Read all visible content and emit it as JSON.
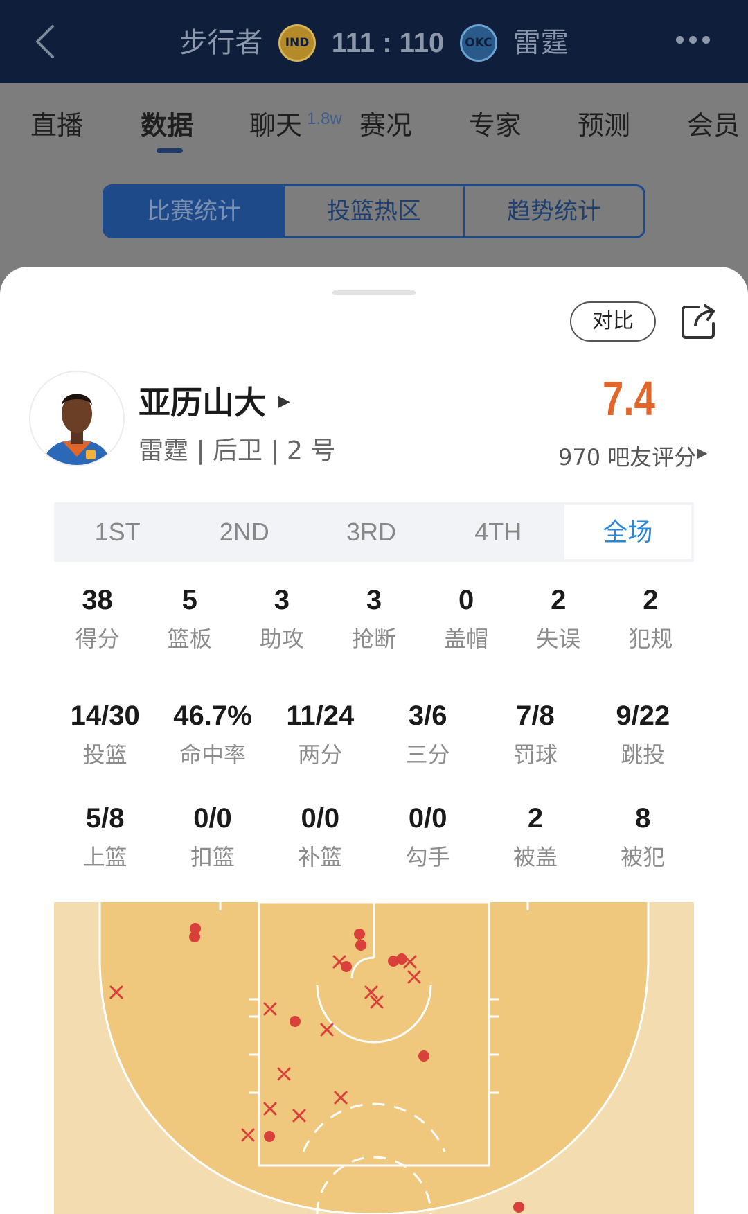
{
  "header": {
    "home_team": "步行者",
    "home_logo": "IND",
    "score": "111 : 110",
    "away_logo": "OKC",
    "away_team": "雷霆",
    "back_icon": "chevron-left-icon",
    "more_icon": "more-dots-icon"
  },
  "tabs": [
    {
      "label": "直播",
      "active": false
    },
    {
      "label": "数据",
      "active": true
    },
    {
      "label": "聊天",
      "active": false,
      "badge": "1.8w"
    },
    {
      "label": "赛况",
      "active": false
    },
    {
      "label": "专家",
      "active": false
    },
    {
      "label": "预测",
      "active": false
    },
    {
      "label": "会员",
      "active": false
    }
  ],
  "segments": [
    {
      "label": "比赛统计",
      "active": true
    },
    {
      "label": "投篮热区",
      "active": false
    },
    {
      "label": "趋势统计",
      "active": false
    }
  ],
  "sheet": {
    "compare_label": "对比",
    "share_icon": "share-icon"
  },
  "player": {
    "name": "亚历山大",
    "meta": "雷霆 | 后卫 | 2 号",
    "rating": "7.4",
    "rating_count": "970 吧友评分"
  },
  "quarters": [
    {
      "label": "1ST",
      "active": false
    },
    {
      "label": "2ND",
      "active": false
    },
    {
      "label": "3RD",
      "active": false
    },
    {
      "label": "4TH",
      "active": false
    },
    {
      "label": "全场",
      "active": true
    }
  ],
  "stats_row1": [
    {
      "value": "38",
      "label": "得分"
    },
    {
      "value": "5",
      "label": "篮板"
    },
    {
      "value": "3",
      "label": "助攻"
    },
    {
      "value": "3",
      "label": "抢断"
    },
    {
      "value": "0",
      "label": "盖帽"
    },
    {
      "value": "2",
      "label": "失误"
    },
    {
      "value": "2",
      "label": "犯规"
    }
  ],
  "stats_row2": [
    {
      "value": "14/30",
      "label": "投篮"
    },
    {
      "value": "46.7%",
      "label": "命中率"
    },
    {
      "value": "11/24",
      "label": "两分"
    },
    {
      "value": "3/6",
      "label": "三分"
    },
    {
      "value": "7/8",
      "label": "罚球"
    },
    {
      "value": "9/22",
      "label": "跳投"
    }
  ],
  "stats_row3": [
    {
      "value": "5/8",
      "label": "上篮"
    },
    {
      "value": "0/0",
      "label": "扣篮"
    },
    {
      "value": "0/0",
      "label": "补篮"
    },
    {
      "value": "0/0",
      "label": "勾手"
    },
    {
      "value": "2",
      "label": "被盖"
    },
    {
      "value": "8",
      "label": "被犯"
    }
  ],
  "shots": {
    "made_color": "#d9403a",
    "miss_color": "#d9403a",
    "court_color": "#efc77d",
    "court_outer_color": "#f3dcb0"
  }
}
